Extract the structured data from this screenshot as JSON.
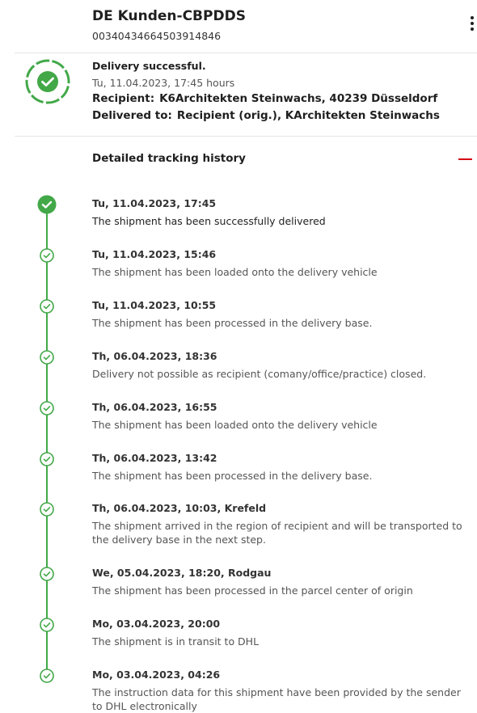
{
  "header": {
    "title": "DE Kunden-CBPDDS",
    "tracking_number": "00340434664503914846",
    "menu_icon": "more-vertical-icon"
  },
  "status": {
    "icon": "check-circle-icon",
    "title": "Delivery successful.",
    "date": "Tu, 11.04.2023, 17:45 hours",
    "recipient_label": "Recipient:",
    "recipient_value": "K6Architekten Steinwachs, 40239 Düsseldorf",
    "delivered_label": "Delivered to:",
    "delivered_value": "Recipient (orig.), KArchitekten Steinwachs"
  },
  "history": {
    "heading": "Detailed tracking history",
    "collapse_icon": "minus-icon",
    "accent_color": "#d40511",
    "line_color": "#42a848",
    "events": [
      {
        "date": "Tu, 11.04.2023, 17:45",
        "description": "The shipment has been successfully delivered"
      },
      {
        "date": "Tu, 11.04.2023, 15:46",
        "description": "The shipment has been loaded onto the delivery vehicle"
      },
      {
        "date": "Tu, 11.04.2023, 10:55",
        "description": "The shipment has been processed in the delivery base."
      },
      {
        "date": "Th, 06.04.2023, 18:36",
        "description": "Delivery not possible as recipient (comany/office/practice) closed."
      },
      {
        "date": "Th, 06.04.2023, 16:55",
        "description": "The shipment has been loaded onto the delivery vehicle"
      },
      {
        "date": "Th, 06.04.2023, 13:42",
        "description": "The shipment has been processed in the delivery base."
      },
      {
        "date": "Th, 06.04.2023, 10:03, Krefeld",
        "description": "The shipment arrived in the region of recipient and will be transported to the delivery base in the next step."
      },
      {
        "date": "We, 05.04.2023, 18:20, Rodgau",
        "description": "The shipment has been processed in the parcel center of origin"
      },
      {
        "date": "Mo, 03.04.2023, 20:00",
        "description": "The shipment is in transit to DHL"
      },
      {
        "date": "Mo, 03.04.2023, 04:26",
        "description": "The instruction data for this shipment have been provided by the sender to DHL electronically"
      }
    ]
  }
}
